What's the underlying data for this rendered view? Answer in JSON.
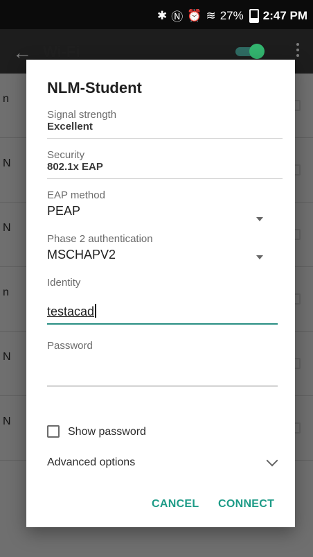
{
  "status_bar": {
    "battery": "27%",
    "time": "2:47 PM"
  },
  "app_bar": {
    "title": "Wi-Fi"
  },
  "background_list": [
    "n",
    "N",
    "N",
    "n",
    "N",
    "N"
  ],
  "dialog": {
    "title": "NLM-Student",
    "signal": {
      "label": "Signal strength",
      "value": "Excellent"
    },
    "security": {
      "label": "Security",
      "value": "802.1x EAP"
    },
    "eap_method": {
      "label": "EAP method",
      "value": "PEAP"
    },
    "phase2": {
      "label": "Phase 2 authentication",
      "value": "MSCHAPV2"
    },
    "identity": {
      "label": "Identity",
      "value": "testacad"
    },
    "password": {
      "label": "Password",
      "value": ""
    },
    "show_password": {
      "label": "Show password",
      "checked": false
    },
    "advanced": {
      "label": "Advanced options"
    },
    "buttons": {
      "cancel": "CANCEL",
      "connect": "CONNECT"
    }
  }
}
